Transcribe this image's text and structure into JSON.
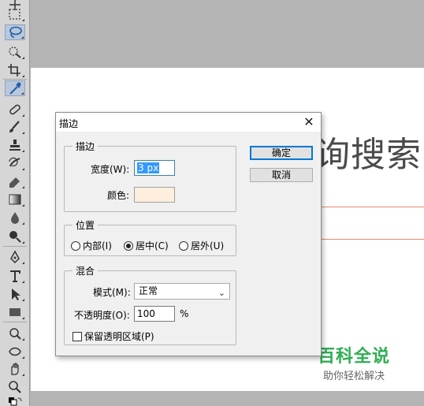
{
  "canvas": {
    "text": "询搜索",
    "guide_color": "#e58a6f"
  },
  "watermark": {
    "title": "百科全说",
    "subtitle": "助你轻松解决",
    "accent": "#2fae52"
  },
  "toolbar": {
    "tools": [
      "move-tool-icon",
      "marquee-tool-icon",
      "lasso-tool-icon",
      "quick-selection-icon",
      "crop-tool-icon",
      "eyedropper-tool-icon",
      "healing-brush-icon",
      "brush-tool-icon",
      "clone-stamp-icon",
      "history-brush-icon",
      "eraser-tool-icon",
      "gradient-tool-icon",
      "blur-tool-icon",
      "dodge-tool-icon",
      "pen-tool-icon",
      "type-tool-icon",
      "path-selection-icon",
      "rectangle-tool-icon",
      "rotate-view-icon",
      "hand-tool-icon",
      "zoom-tool-icon",
      "default-colors-icon"
    ],
    "active_tools": [
      "lasso-tool-icon",
      "eyedropper-tool-icon"
    ]
  },
  "dialog": {
    "title": "描边",
    "close": "✕",
    "stroke_group": {
      "label": "描边",
      "width_label": "宽度(W):",
      "width_value": "3 px",
      "color_label": "颜色:",
      "color_value": "#fdeedd"
    },
    "position_group": {
      "label": "位置",
      "options": [
        "内部(I)",
        "居中(C)",
        "居外(U)"
      ],
      "selected": "居中(C)"
    },
    "blend_group": {
      "label": "混合",
      "mode_label": "模式(M):",
      "mode_value": "正常",
      "opacity_label": "不透明度(O):",
      "opacity_value": "100",
      "opacity_unit": "%",
      "preserve_label": "保留透明区域(P)",
      "preserve_checked": false
    },
    "buttons": {
      "ok": "确定",
      "cancel": "取消"
    }
  }
}
